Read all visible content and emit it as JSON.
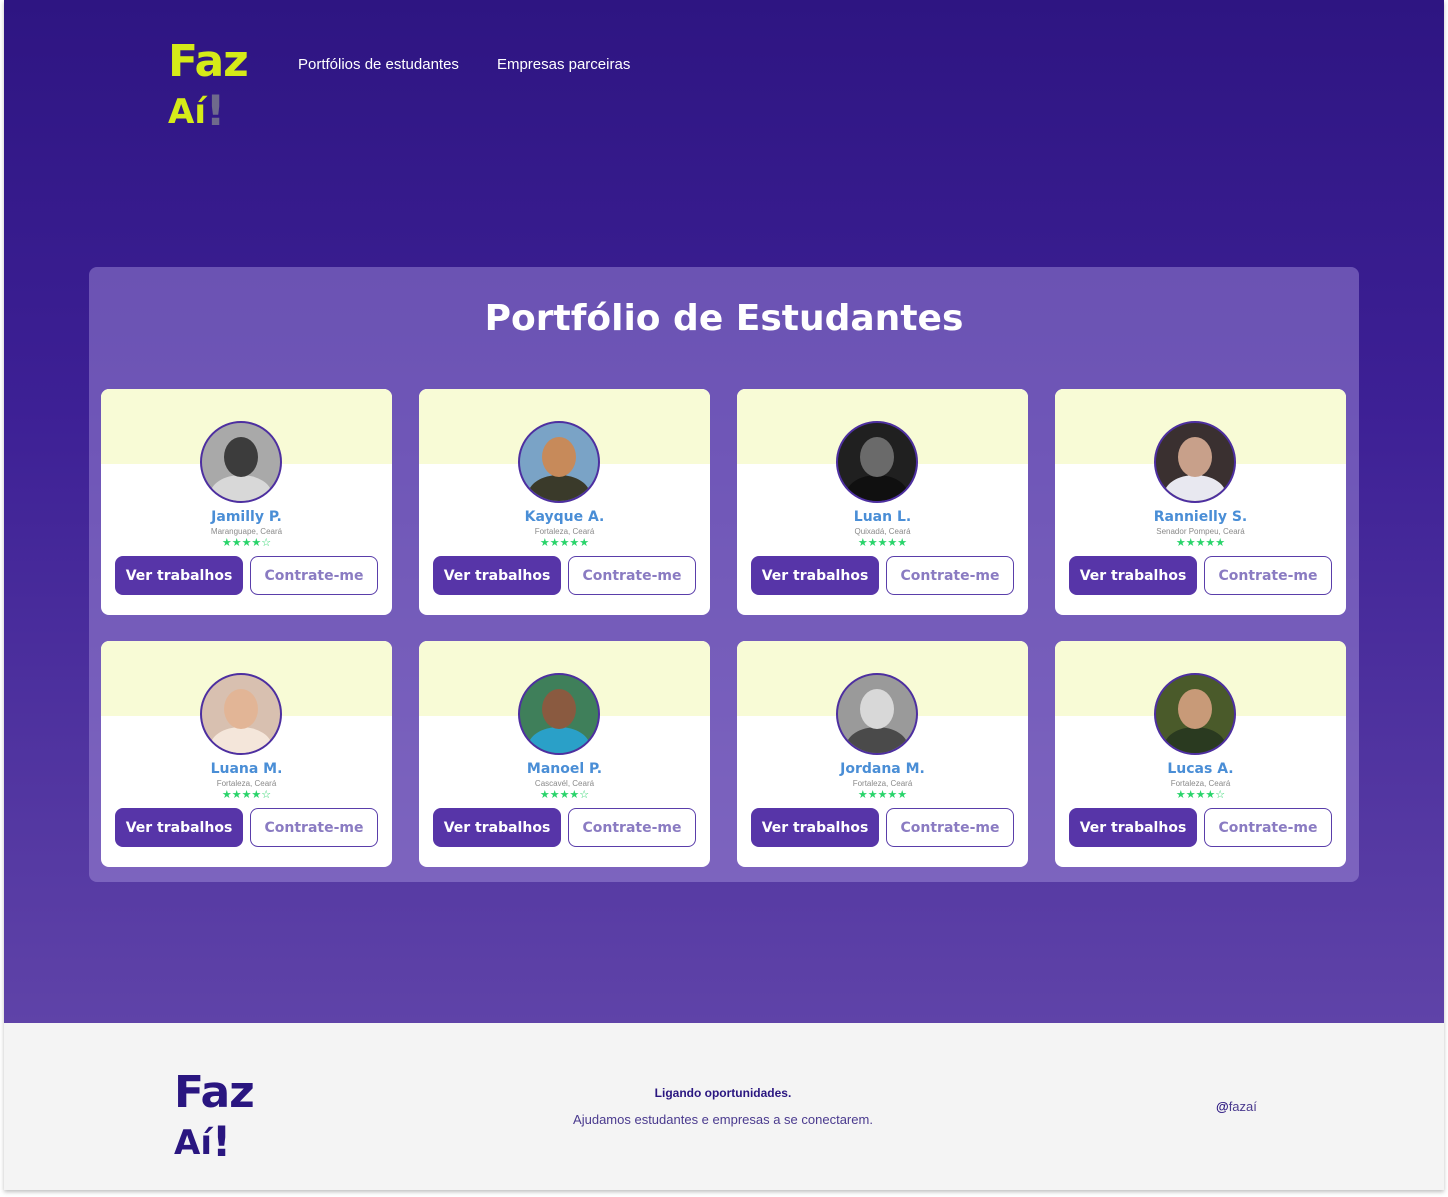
{
  "header": {
    "logo": {
      "line1": "Faz",
      "line2": "Aí",
      "bang": "!"
    },
    "nav": [
      "Portfólios de estudantes",
      "Empresas parceiras"
    ]
  },
  "portfolio": {
    "title": "Portfólio de Estudantes",
    "buttons": {
      "primary": "Ver trabalhos",
      "secondary": "Contrate-me"
    },
    "students": [
      {
        "name": "Jamilly P.",
        "location": "Maranguape, Ceará",
        "rating": 4,
        "stars": "★★★★☆"
      },
      {
        "name": "Kayque A.",
        "location": "Fortaleza, Ceará",
        "rating": 5,
        "stars": "★★★★★"
      },
      {
        "name": "Luan L.",
        "location": "Quixadá, Ceará",
        "rating": 5,
        "stars": "★★★★★"
      },
      {
        "name": "Rannielly S.",
        "location": "Senador Pompeu, Ceará",
        "rating": 5,
        "stars": "★★★★★"
      },
      {
        "name": "Luana M.",
        "location": "Fortaleza, Ceará",
        "rating": 4,
        "stars": "★★★★☆"
      },
      {
        "name": "Manoel P.",
        "location": "Cascavél, Ceará",
        "rating": 4,
        "stars": "★★★★☆"
      },
      {
        "name": "Jordana M.",
        "location": "Fortaleza, Ceará",
        "rating": 5,
        "stars": "★★★★★"
      },
      {
        "name": "Lucas A.",
        "location": "Fortaleza, Ceará",
        "rating": 4,
        "stars": "★★★★☆"
      }
    ]
  },
  "footer": {
    "logo": {
      "line1": "Faz",
      "line2": "Aí",
      "bang": "!"
    },
    "tagline": "Ligando oportunidades.",
    "description": "Ajudamos estudantes e empresas a se conectarem.",
    "handle_at": "@",
    "handle": "fazaí"
  },
  "colors": {
    "hero_top": "#2e1582",
    "hero_bottom": "#5f43a8",
    "logo_yellow": "#d5ea18",
    "primary_button": "#5735a8",
    "name_blue": "#4a8ed6",
    "star_green": "#29d46a",
    "card_band": "#f8fbd6",
    "footer_bg": "#f4f4f4"
  }
}
